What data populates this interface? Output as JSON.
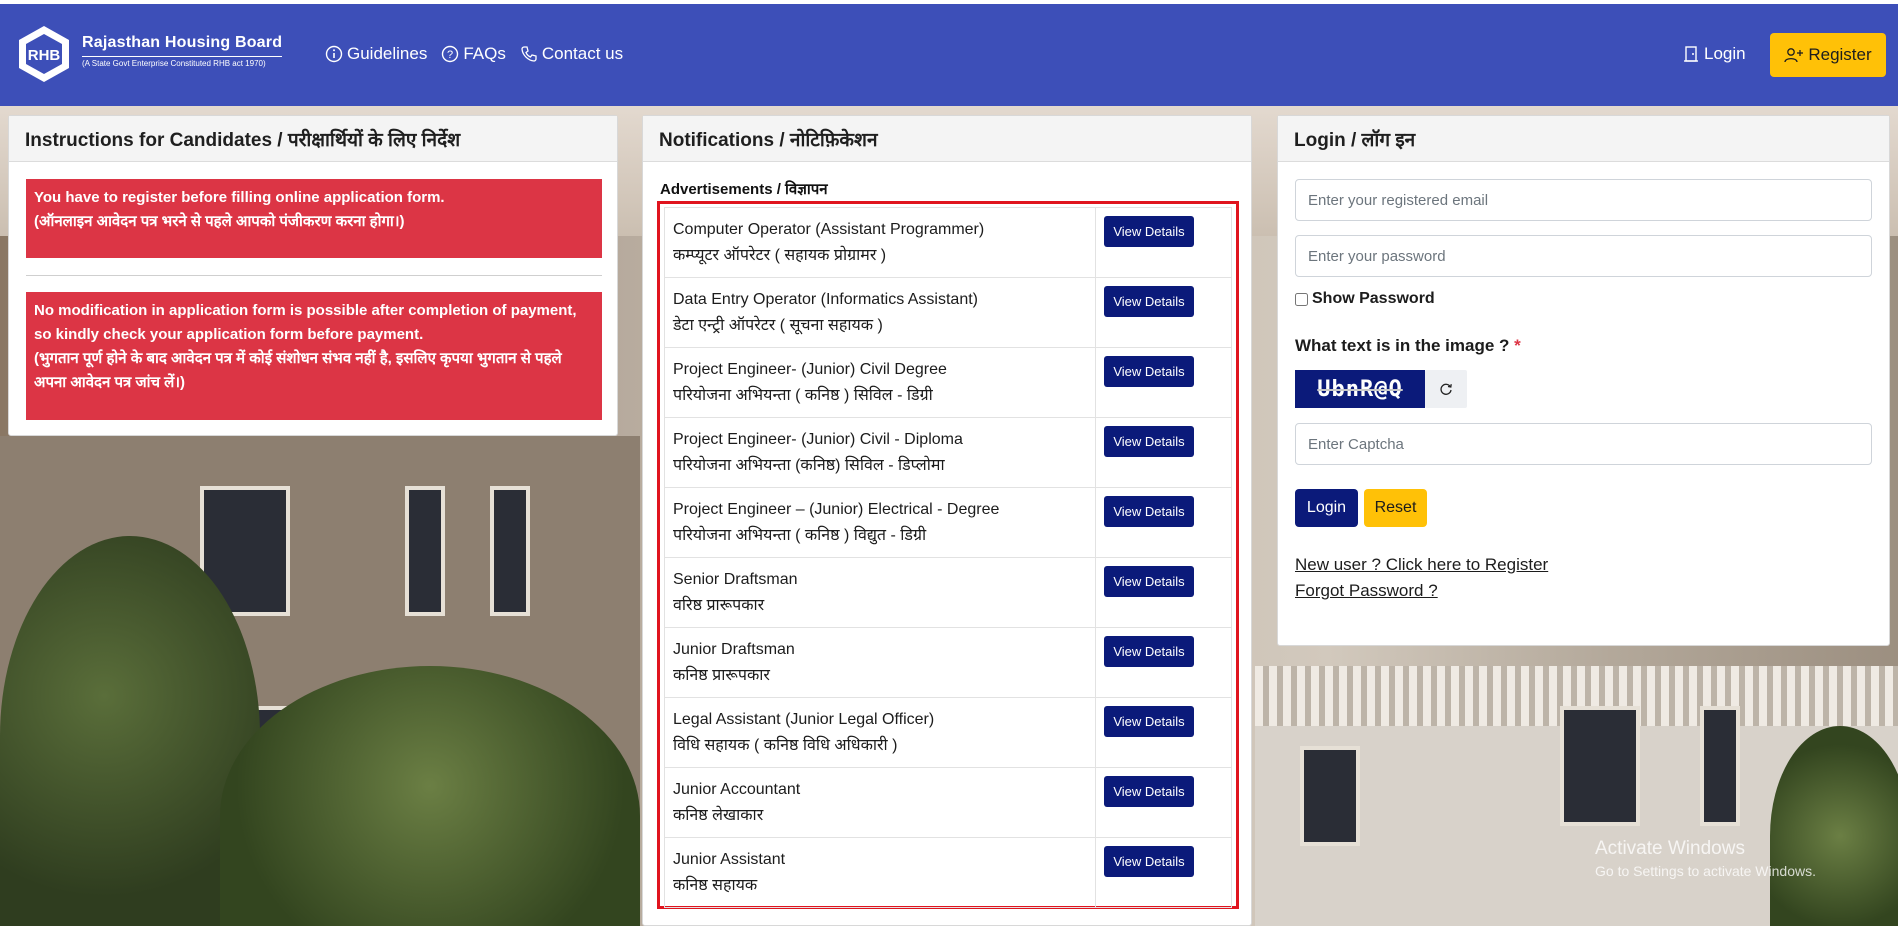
{
  "header": {
    "brand_title": "Rajasthan Housing Board",
    "brand_subtitle": "(A State Govt Enterprise Constituted RHB act 1970)",
    "logo_text": "RHB",
    "nav": [
      {
        "label": "Guidelines",
        "icon": "info-circle-icon"
      },
      {
        "label": "FAQs",
        "icon": "question-circle-icon"
      },
      {
        "label": "Contact us",
        "icon": "phone-icon"
      }
    ],
    "login_label": "Login",
    "register_label": "Register"
  },
  "instructions": {
    "title": "Instructions for Candidates / परीक्षार्थियों के लिए निर्देश",
    "alert1_line1": "You have to register before filling online application form.",
    "alert1_line2": "(ऑनलाइन आवेदन पत्र भरने से पहले आपको पंजीकरण करना होगा।)",
    "alert2_line1": "No modification in application form is possible after completion of payment,",
    "alert2_line2": "so kindly check your application form before payment.",
    "alert2_line3": "(भुगतान पूर्ण होने के बाद आवेदन पत्र में कोई संशोधन संभव नहीं है, इसलिए कृपया भुगतान से पहले",
    "alert2_line4": "अपना आवेदन पत्र जांच लें।)"
  },
  "notifications": {
    "title": "Notifications / नोटिफ़िकेशन",
    "adv_label": "Advertisements / विज्ञापन",
    "view_label": "View Details",
    "items": [
      {
        "en": "Computer Operator (Assistant Programmer)",
        "hi": "कम्प्यूटर ऑपरेटर ( सहायक प्रोग्रामर )"
      },
      {
        "en": "Data Entry Operator (Informatics Assistant)",
        "hi": "डेटा एन्ट्री ऑपरेटर ( सूचना सहायक )"
      },
      {
        "en": "Project Engineer- (Junior) Civil Degree",
        "hi": "परियोजना अभियन्ता ( कनिष्ठ ) सिविल - डिग्री"
      },
      {
        "en": "Project Engineer- (Junior) Civil - Diploma",
        "hi": "परियोजना अभियन्ता (कनिष्ठ) सिविल - डिप्लोमा"
      },
      {
        "en": "Project Engineer – (Junior) Electrical - Degree",
        "hi": "परियोजना अभियन्ता ( कनिष्ठ ) विद्युत - डिग्री"
      },
      {
        "en": "Senior Draftsman",
        "hi": "वरिष्ठ प्रारूपकार"
      },
      {
        "en": "Junior Draftsman",
        "hi": "कनिष्ठ प्रारूपकार"
      },
      {
        "en": "Legal Assistant (Junior Legal Officer)",
        "hi": "विधि सहायक ( कनिष्ठ विधि अधिकारी )"
      },
      {
        "en": "Junior Accountant",
        "hi": "कनिष्ठ लेखाकार"
      },
      {
        "en": "Junior Assistant",
        "hi": "कनिष्ठ सहायक"
      }
    ]
  },
  "login": {
    "title": "Login / लॉग इन",
    "email_placeholder": "Enter your registered email",
    "password_placeholder": "Enter your password",
    "show_password": "Show Password",
    "captcha_question": "What text is in the image ?",
    "captcha_required": "*",
    "captcha_text": "UbnR@Q",
    "captcha_placeholder": "Enter Captcha",
    "login_button": "Login",
    "reset_button": "Reset",
    "register_link": "New user ? Click here to Register",
    "forgot_link": "Forgot Password ?"
  },
  "watermark": {
    "line1": "Activate Windows",
    "line2": "Go to Settings to activate Windows."
  },
  "colors": {
    "header_bg": "#3d4fb8",
    "alert_red": "#dc3545",
    "primary_navy": "#0b1a7a",
    "warning_yellow": "#ffc107",
    "highlight_border": "#e0141e"
  }
}
